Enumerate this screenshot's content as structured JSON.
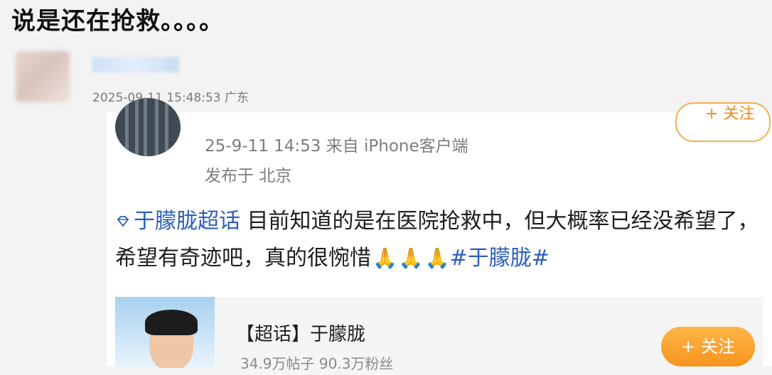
{
  "headline": "说是还在抢救。。。。",
  "outer_post": {
    "meta": "2025-09-11 15:48:53 广东"
  },
  "embedded_post": {
    "follow_label": "+ 关注",
    "meta": "25-9-11 14:53  来自 iPhone客户端",
    "location": "发布于 北京",
    "super_topic": "于朦胧超话",
    "body": " 目前知道的是在医院抢救中，但大概率已经没希望了，希望有奇迹吧，真的很惋惜",
    "emoji": "🙏",
    "hashtag": "#于朦胧#"
  },
  "card": {
    "title": "【超话】于朦胧",
    "stats": "34.9万帖子  90.3万粉丝",
    "follow_label": "+ 关注"
  },
  "colors": {
    "link": "#2c5fb8",
    "follow_orange": "#f7941e",
    "meta_gray": "#7d7d7d"
  }
}
